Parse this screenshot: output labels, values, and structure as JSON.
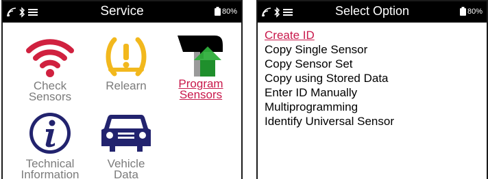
{
  "left_screen": {
    "title": "Service",
    "battery": "80%",
    "tiles": [
      {
        "label_line1": "Check",
        "label_line2": "Sensors",
        "icon": "wifi-signal-icon",
        "color": "#d0213f"
      },
      {
        "label_line1": "Relearn",
        "label_line2": "",
        "icon": "tpms-warning-icon",
        "color": "#f2b81d"
      },
      {
        "label_line1": "Program",
        "label_line2": "Sensors",
        "icon": "program-sensor-icon",
        "color": "#c8174a"
      },
      {
        "label_line1": "Technical",
        "label_line2": "Information",
        "icon": "info-icon",
        "color": "#22236e"
      },
      {
        "label_line1": "Vehicle",
        "label_line2": "Data",
        "icon": "car-icon",
        "color": "#22236e"
      }
    ]
  },
  "right_screen": {
    "title": "Select Option",
    "battery": "80%",
    "options": [
      "Create ID",
      "Copy Single Sensor",
      "Copy Sensor Set",
      "Copy using Stored Data",
      "Enter ID Manually",
      "Multiprogramming",
      "Identify Universal Sensor"
    ],
    "selected_index": 0
  },
  "colors": {
    "accent": "#c8174a",
    "label_gray": "#7b7b7b",
    "statusbar": "#000000"
  }
}
